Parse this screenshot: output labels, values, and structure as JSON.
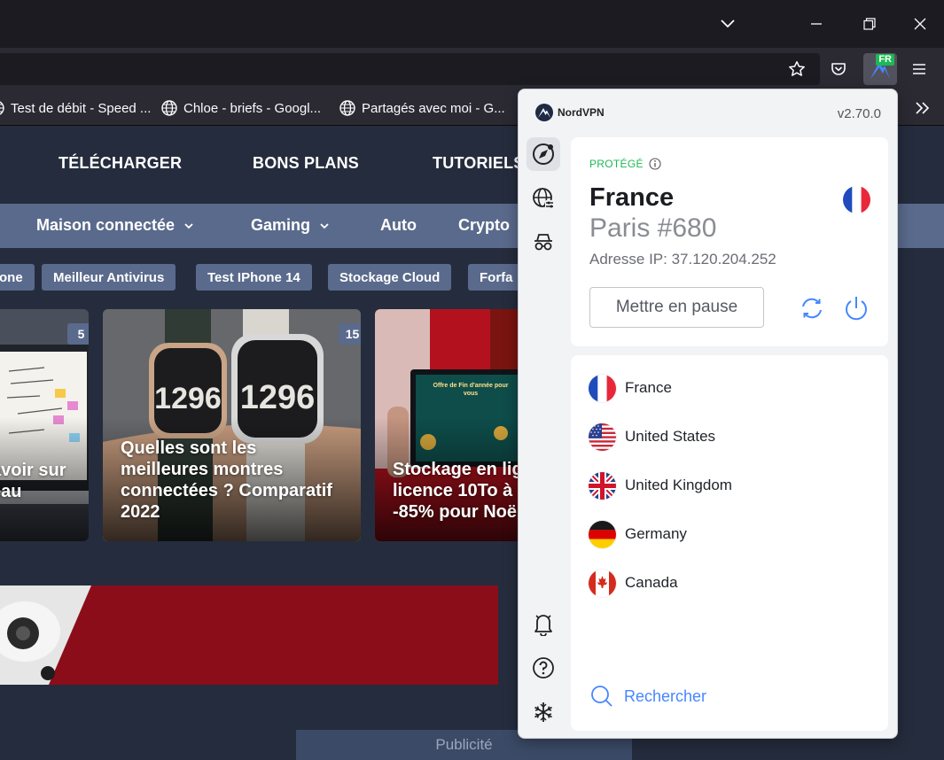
{
  "browser": {
    "extension_badge": "FR",
    "bookmarks": [
      {
        "label": "Test de débit - Speed ..."
      },
      {
        "label": "Chloe - briefs - Googl..."
      },
      {
        "label": "Partagés avec moi - G..."
      }
    ]
  },
  "site": {
    "main_nav": [
      "TÉLÉCHARGER",
      "BONS PLANS",
      "TUTORIELS"
    ],
    "sub_nav": [
      {
        "label": "Maison connectée",
        "has_dropdown": true
      },
      {
        "label": "Gaming",
        "has_dropdown": true
      },
      {
        "label": "Auto",
        "has_dropdown": false
      },
      {
        "label": "Crypto",
        "has_dropdown": false
      }
    ],
    "tags": [
      "one",
      "Meilleur Antivirus",
      "Test IPhone 14",
      "Stockage Cloud",
      "Forfa"
    ],
    "cards": [
      {
        "count": "5",
        "title_lines": [
          "avoir sur",
          "eau"
        ]
      },
      {
        "count": "15",
        "title_lines": [
          "Quelles sont les",
          "meilleures montres",
          "connectées ? Comparatif",
          "2022"
        ]
      },
      {
        "title_lines": [
          "Stockage en lig",
          "licence 10To à",
          "-85% pour Noë"
        ],
        "promo_text": "Offre de Fin d'année pour vous"
      }
    ],
    "ad_label": "Publicité"
  },
  "vpn": {
    "brand": "NordVPN",
    "version": "v2.70.0",
    "status": "PROTÉGÉ",
    "country": "France",
    "server": "Paris #680",
    "ip_label": "Adresse IP: 37.120.204.252",
    "pause_label": "Mettre en pause",
    "countries": [
      {
        "name": "France",
        "flag": "fr"
      },
      {
        "name": "United States",
        "flag": "us"
      },
      {
        "name": "United Kingdom",
        "flag": "gb"
      },
      {
        "name": "Germany",
        "flag": "de"
      },
      {
        "name": "Canada",
        "flag": "ca"
      }
    ],
    "search_label": "Rechercher",
    "colors": {
      "protected": "#1db954",
      "accent": "#4687ff"
    }
  }
}
